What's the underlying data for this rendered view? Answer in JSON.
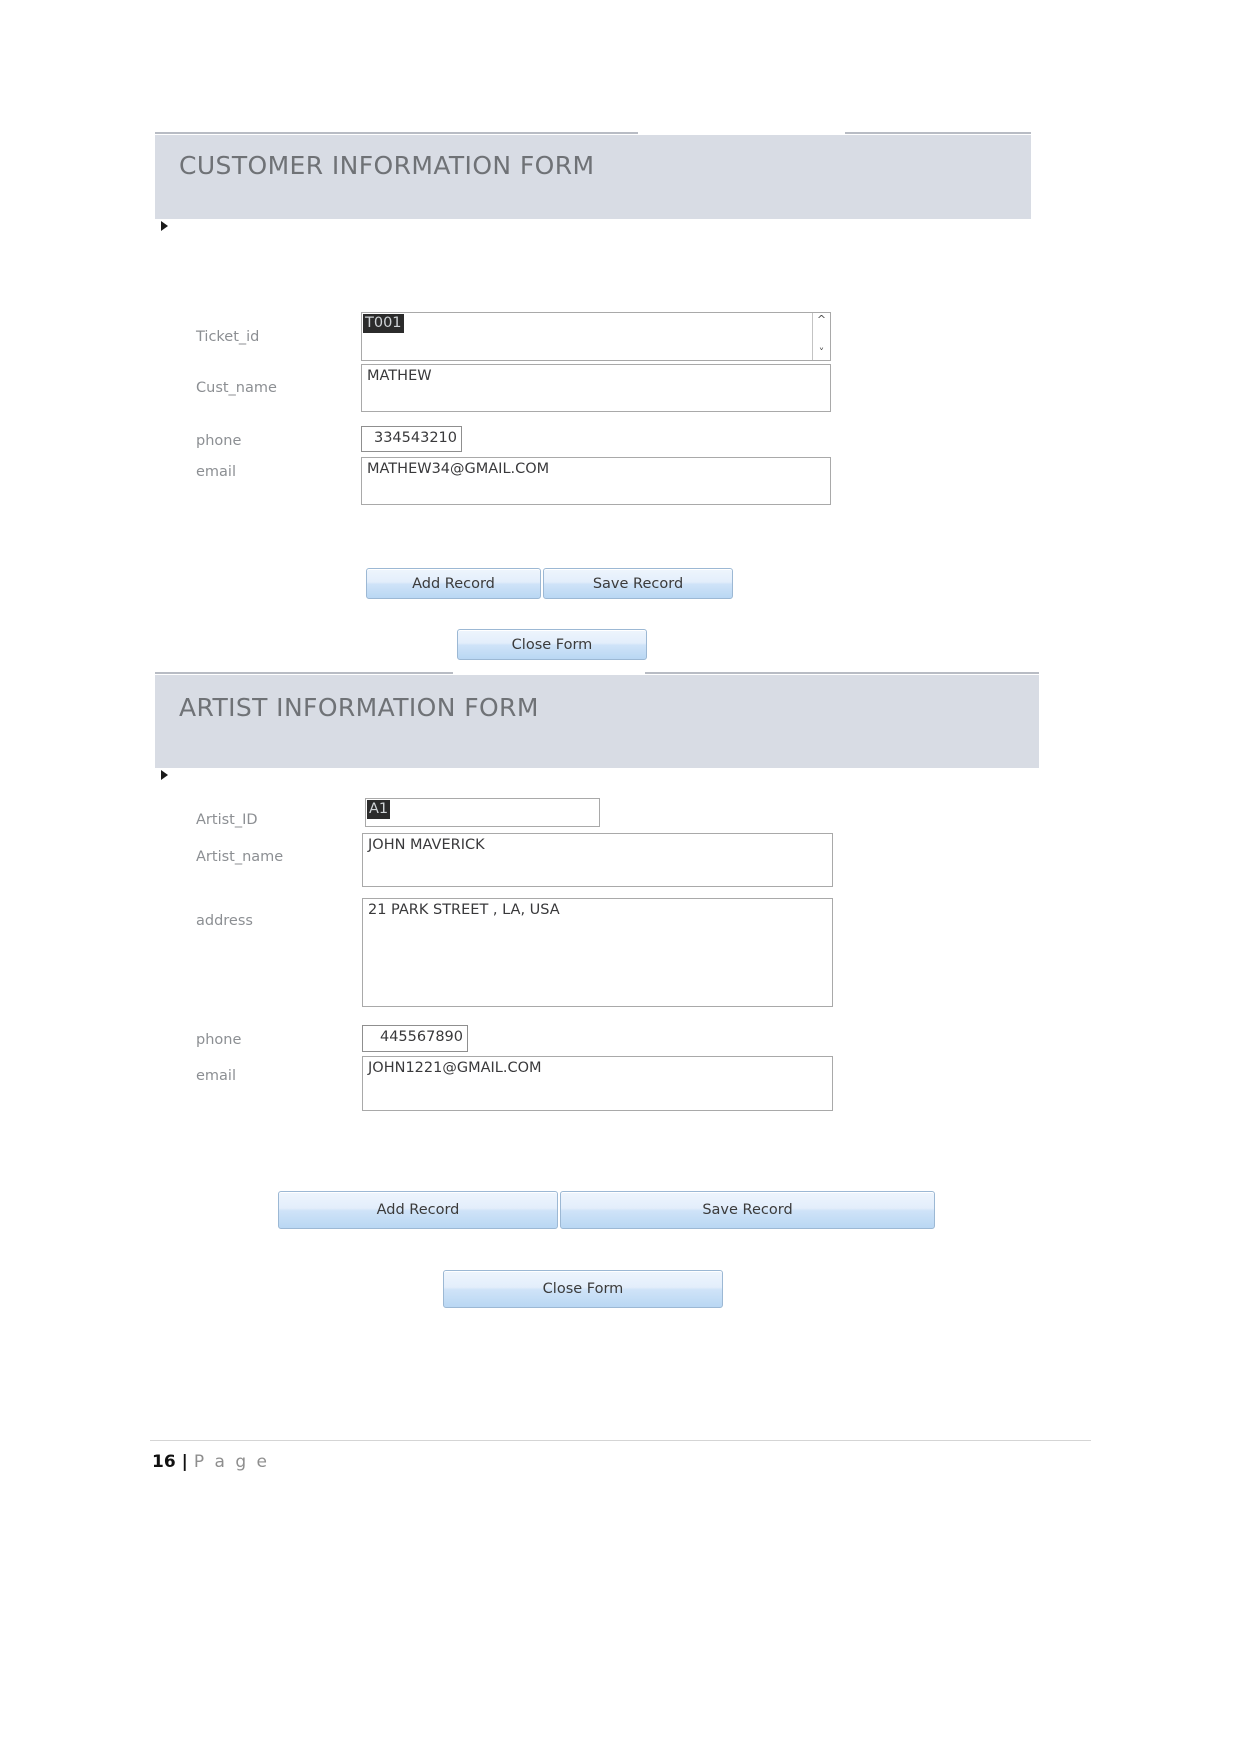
{
  "document": {
    "footer": {
      "page_number": "16",
      "separator": "|",
      "label": "P a g e"
    }
  },
  "forms": [
    {
      "id": "customer-information-form",
      "title": "CUSTOMER INFORMATION FORM",
      "fields": [
        {
          "name": "ticket-id",
          "label": "Ticket_id",
          "value": "T001",
          "control": "combo-box",
          "selected": true,
          "scroll_up_icon": "chevron-up-icon",
          "scroll_down_icon": "chevron-down-icon"
        },
        {
          "name": "cust-name",
          "label": "Cust_name",
          "value": "MATHEW",
          "control": "text-box"
        },
        {
          "name": "phone",
          "label": "phone",
          "value": "334543210",
          "control": "number-box"
        },
        {
          "name": "email",
          "label": "email",
          "value": "MATHEW34@GMAIL.COM",
          "control": "text-box"
        }
      ],
      "buttons": {
        "add_record": "Add Record",
        "save_record": "Save Record",
        "close_form": "Close Form"
      }
    },
    {
      "id": "artist-information-form",
      "title": "ARTIST INFORMATION FORM",
      "fields": [
        {
          "name": "artist-id",
          "label": "Artist_ID",
          "value": "A1",
          "control": "text-box",
          "selected": true
        },
        {
          "name": "artist-name",
          "label": "Artist_name",
          "value": "JOHN MAVERICK",
          "control": "text-box"
        },
        {
          "name": "address",
          "label": "address",
          "value": "21 PARK STREET , LA, USA",
          "control": "text-box"
        },
        {
          "name": "phone",
          "label": "phone",
          "value": "445567890",
          "control": "number-box"
        },
        {
          "name": "email",
          "label": "email",
          "value": "JOHN1221@GMAIL.COM",
          "control": "text-box"
        }
      ],
      "buttons": {
        "add_record": "Add Record",
        "save_record": "Save Record",
        "close_form": "Close Form"
      }
    }
  ],
  "colors": {
    "header_band": "#d8dce4",
    "header_text": "#6f7276",
    "label_text": "#8c8f93",
    "button_border": "#9cb8d4",
    "selection_bg": "#2b2b2b"
  }
}
